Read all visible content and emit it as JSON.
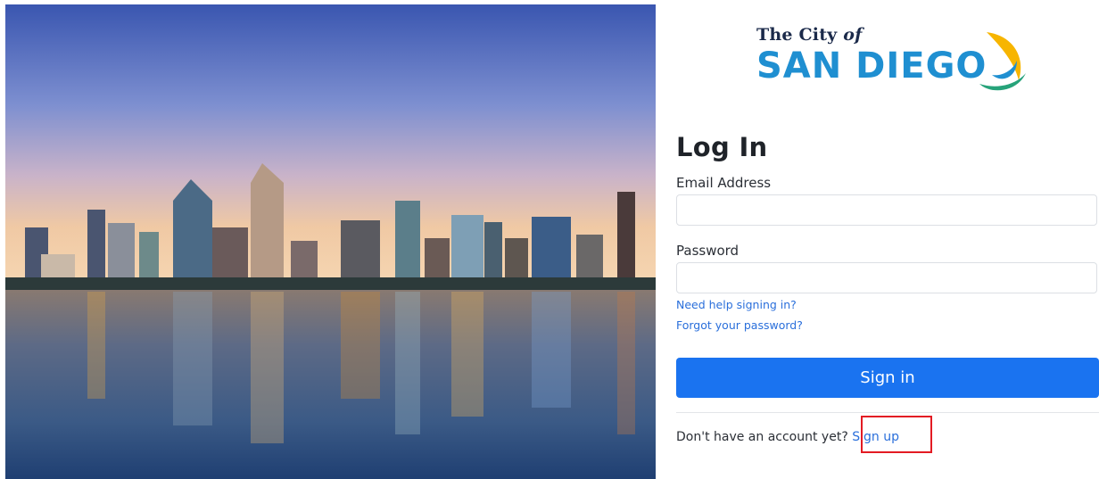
{
  "hero": {
    "image": "san-diego-skyline-photo"
  },
  "logo": {
    "prefix": "The City",
    "prefix_italic": "of",
    "name": "SAN DIEGO",
    "colors": {
      "text": "#1f8fd1",
      "wave_yellow": "#f7b500",
      "wave_blue": "#1f8fd1",
      "wave_green": "#27a37a"
    }
  },
  "form": {
    "title": "Log In",
    "email_label": "Email Address",
    "email_value": "",
    "password_label": "Password",
    "password_value": "",
    "help_link": "Need help signing in?",
    "forgot_link": "Forgot your password?",
    "signin_label": "Sign in"
  },
  "footer": {
    "prompt": "Don't have an account yet?",
    "signup_link": "Sign up"
  },
  "colors": {
    "primary": "#1a73f0",
    "link": "#2a6fdb",
    "annotation": "#e31b23"
  }
}
